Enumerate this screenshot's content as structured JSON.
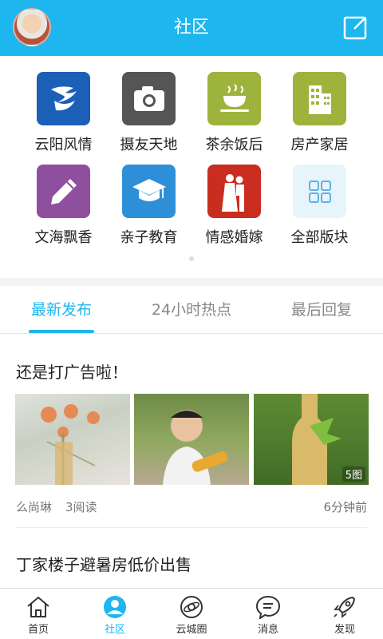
{
  "header": {
    "title": "社区"
  },
  "categories": [
    {
      "label": "云阳风情",
      "icon": "yunyang-icon",
      "color": "#1c5fb7"
    },
    {
      "label": "摄友天地",
      "icon": "camera-icon",
      "color": "#555555"
    },
    {
      "label": "茶余饭后",
      "icon": "coffee-cup-icon",
      "color": "#9eb33b"
    },
    {
      "label": "房产家居",
      "icon": "building-icon",
      "color": "#9eb33b"
    },
    {
      "label": "文海飘香",
      "icon": "pencil-icon",
      "color": "#8e4f9e"
    },
    {
      "label": "亲子教育",
      "icon": "graduation-cap-icon",
      "color": "#2d8fd8"
    },
    {
      "label": "情感婚嫁",
      "icon": "couple-icon",
      "color": "#c92d1f"
    },
    {
      "label": "全部版块",
      "icon": "grid-icon",
      "color": "#e7f4fb"
    }
  ],
  "tabs": [
    "最新发布",
    "24小时热点",
    "最后回复"
  ],
  "posts": [
    {
      "title": "还是打广告啦！",
      "author": "么尚琳",
      "reads": "3阅读",
      "time": "6分钟前",
      "image_count": "5图"
    },
    {
      "title": "丁家楼子避暑房低价出售"
    }
  ],
  "nav": [
    "首页",
    "社区",
    "云城圈",
    "消息",
    "发现"
  ],
  "colors": {
    "accent": "#1eb6ee"
  }
}
